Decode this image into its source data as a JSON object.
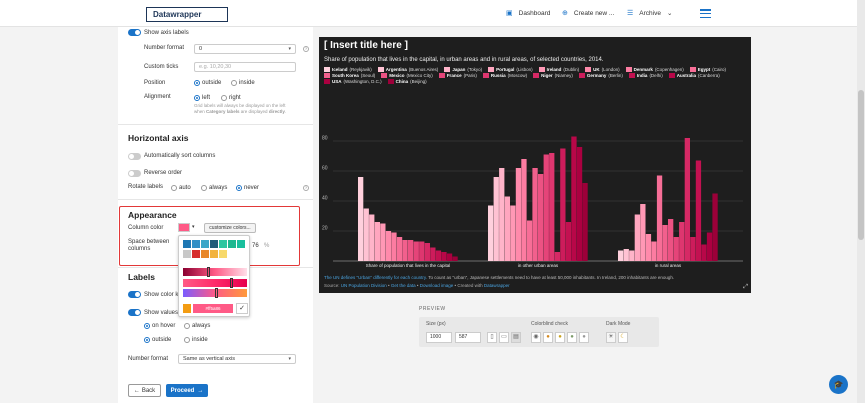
{
  "header": {
    "logo": "Datawrapper",
    "dashboard": "Dashboard",
    "create_new": "Create new ...",
    "archive": "Archive"
  },
  "sidebar": {
    "show_axis_labels": "Show axis labels",
    "number_format_label": "Number format",
    "number_format_value": "0",
    "custom_ticks_label": "Custom ticks",
    "custom_ticks_placeholder": "e.g. 10,20,30",
    "position_label": "Position",
    "position_outside": "outside",
    "position_inside": "inside",
    "alignment_label": "Alignment",
    "alignment_left": "left",
    "alignment_right": "right",
    "grid_hint_1": "Grid labels will always be displayed on the left",
    "grid_hint_2a": "when ",
    "grid_hint_2b": "Category labels",
    "grid_hint_2c": " are displayed ",
    "grid_hint_2d": "directly",
    "grid_hint_2e": ".",
    "horizontal_axis_heading": "Horizontal axis",
    "auto_sort": "Automatically sort columns",
    "reverse_order": "Reverse order",
    "rotate_labels_label": "Rotate labels",
    "rotate_auto": "auto",
    "rotate_always": "always",
    "rotate_never": "never",
    "appearance_heading": "Appearance",
    "column_color_label": "Column color",
    "customize_colors": "customize colors...",
    "space_between_label": "Space between columns",
    "space_value": "76",
    "space_unit": "%",
    "labels_heading": "Labels",
    "show_color_key": "Show color k",
    "show_values": "Show values",
    "on_hover": "on hover",
    "always": "always",
    "outside": "outside",
    "inside": "inside",
    "number_format2_label": "Number format",
    "number_format2_value": "Same as vertical axis"
  },
  "picker": {
    "hex_value": "#ff5a86",
    "confirm_icon": "check-icon",
    "palette": [
      "#1f78b4",
      "#2f8fc6",
      "#3aa6c8",
      "#1f5c7a",
      "#2cc6a0",
      "#1db890",
      "#1abf9d",
      "#c8c8c8",
      "#d62d2d",
      "#e8872a",
      "#f2b33c",
      "#f7d96b"
    ],
    "selected": "#ff5a86"
  },
  "chart": {
    "title": "[ Insert title here ]",
    "subtitle": "Share of population that lives in the capital, in urban areas and in rural areas, of selected countries, 2014.",
    "note_blue": "The UN defines \"Urban\" differently for each country.",
    "note_rest": " To count as \"urban\", Japanese settlements need to have at least 50,000 inhabitants. In Ireland, 200 inhabitants are enough.",
    "source_prefix": "Source: ",
    "source_link": "UN Population Division",
    "source_sep1": " • ",
    "get_data": "Get the data",
    "source_sep2": " • ",
    "download_image": "Download image",
    "source_sep3": " • Created with ",
    "created_with": "Datawrapper",
    "legend": [
      {
        "country": "Iceland",
        "city": "(Reykjavik)",
        "color": "#ffd0dd"
      },
      {
        "country": "Argentina",
        "city": "(Buenos Aires)",
        "color": "#ffc2d3"
      },
      {
        "country": "Japan",
        "city": "(Tokyo)",
        "color": "#ffb4c9"
      },
      {
        "country": "Portugal",
        "city": "(Lisbon)",
        "color": "#ffa6bf"
      },
      {
        "country": "Ireland",
        "city": "(Dublin)",
        "color": "#ff98b5"
      },
      {
        "country": "UK",
        "city": "(London)",
        "color": "#ff8aab"
      },
      {
        "country": "Denmark",
        "city": "(Copenhagen)",
        "color": "#fc7ca1"
      },
      {
        "country": "Egypt",
        "city": "(Cairo)",
        "color": "#f76e97"
      },
      {
        "country": "South Korea",
        "city": "(Seoul)",
        "color": "#f2608d"
      },
      {
        "country": "Mexico",
        "city": "(Mexico City)",
        "color": "#ec5283"
      },
      {
        "country": "France",
        "city": "(Paris)",
        "color": "#e54479"
      },
      {
        "country": "Russia",
        "city": "(Moscow)",
        "color": "#de366f"
      },
      {
        "country": "Niger",
        "city": "(Niamey)",
        "color": "#d62965"
      },
      {
        "country": "Germany",
        "city": "(Berlin)",
        "color": "#cd1c5b"
      },
      {
        "country": "India",
        "city": "(Delhi)",
        "color": "#c31151"
      },
      {
        "country": "Australia",
        "city": "(Canberra)",
        "color": "#b80748"
      },
      {
        "country": "USA",
        "city": "(Washington, D.C.)",
        "color": "#ab0040"
      },
      {
        "country": "China",
        "city": "(Beijing)",
        "color": "#9c0039"
      }
    ]
  },
  "chart_data": {
    "type": "bar",
    "title": "[ Insert title here ]",
    "categories": [
      "Share of population that lives in the capital",
      "in other urban areas",
      "in rural areas"
    ],
    "series_order": [
      "Iceland",
      "Argentina",
      "Japan",
      "Portugal",
      "Ireland",
      "UK",
      "Denmark",
      "Egypt",
      "South Korea",
      "Mexico",
      "France",
      "Russia",
      "Niger",
      "Germany",
      "India",
      "Australia",
      "USA",
      "China"
    ],
    "values": [
      [
        56,
        35,
        31,
        26,
        25,
        20,
        19,
        16,
        14,
        14,
        13,
        13,
        12,
        9,
        7,
        6,
        5,
        3
      ],
      [
        37,
        56,
        62,
        43,
        37,
        62,
        68,
        27,
        62,
        58,
        71,
        72,
        6,
        75,
        26,
        83,
        76,
        52
      ],
      [
        7,
        8,
        7,
        31,
        38,
        18,
        13,
        57,
        24,
        28,
        16,
        26,
        82,
        16,
        67,
        11,
        19,
        45
      ]
    ],
    "ylim": [
      0,
      90
    ],
    "yticks": [
      0,
      20,
      40,
      60,
      80
    ],
    "grid": true
  },
  "preview": {
    "heading": "PREVIEW",
    "size_label": "Size (px)",
    "width": "1000",
    "height": "587",
    "colorblind_label": "Colorblind check",
    "dark_mode_label": "Dark Mode"
  },
  "footer": {
    "back": "Back",
    "proceed": "Proceed"
  }
}
